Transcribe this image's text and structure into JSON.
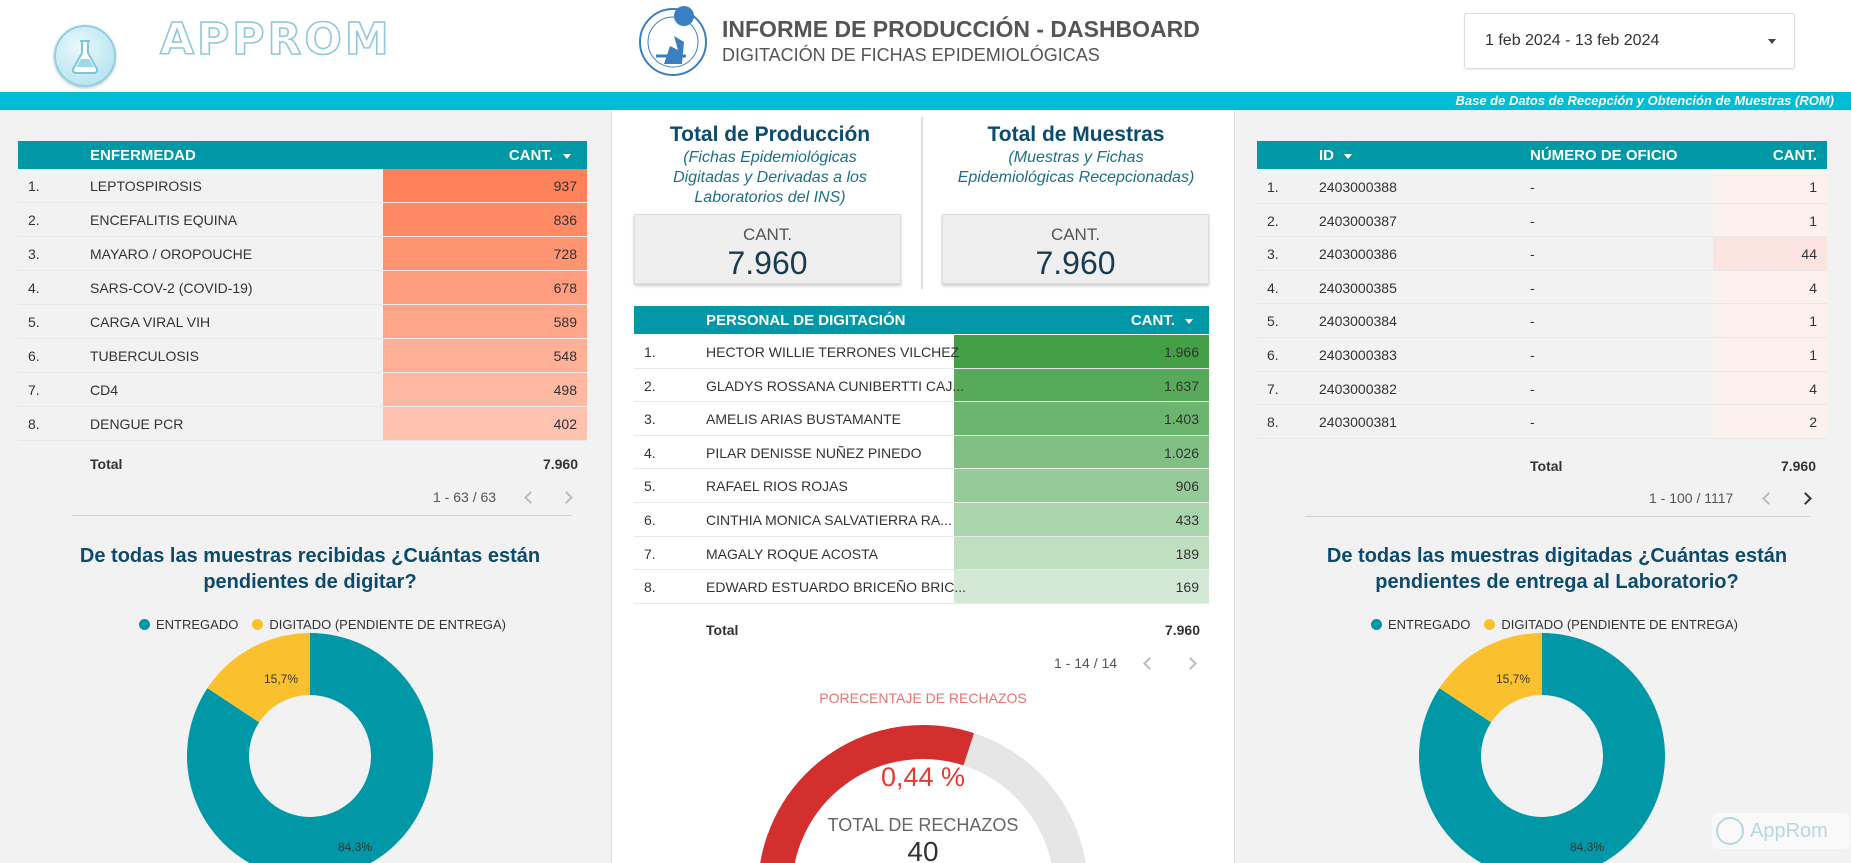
{
  "header": {
    "logo_text": "APPROM",
    "title": "INFORME DE PRODUCCIÓN - DASHBOARD",
    "subtitle": "DIGITACIÓN DE FICHAS EPIDEMIOLÓGICAS",
    "date_range": "1 feb 2024 - 13 feb 2024",
    "band_text": "Base de Datos de Recepción y Obtención de Muestras (ROM)"
  },
  "enfermedad_table": {
    "headers": [
      "ENFERMEDAD",
      "CANT."
    ],
    "rows": [
      {
        "n": "1.",
        "name": "LEPTOSPIROSIS",
        "val": "937",
        "v": 937
      },
      {
        "n": "2.",
        "name": "ENCEFALITIS EQUINA",
        "val": "836",
        "v": 836
      },
      {
        "n": "3.",
        "name": "MAYARO / OROPOUCHE",
        "val": "728",
        "v": 728
      },
      {
        "n": "4.",
        "name": "SARS-COV-2 (COVID-19)",
        "val": "678",
        "v": 678
      },
      {
        "n": "5.",
        "name": "CARGA VIRAL VIH",
        "val": "589",
        "v": 589
      },
      {
        "n": "6.",
        "name": "TUBERCULOSIS",
        "val": "548",
        "v": 548
      },
      {
        "n": "7.",
        "name": "CD4",
        "val": "498",
        "v": 498
      },
      {
        "n": "8.",
        "name": "DENGUE PCR",
        "val": "402",
        "v": 402
      }
    ],
    "total_label": "Total",
    "total_value": "7.960",
    "pagination": "1 - 63 / 63",
    "bar_color": "#ff7043"
  },
  "scorecards": {
    "produccion": {
      "title": "Total de Producción",
      "subtitle": "(Fichas Epidemiológicas Digitadas y Derivadas a los Laboratorios del INS)",
      "label": "CANT.",
      "value": "7.960"
    },
    "muestras": {
      "title": "Total de Muestras",
      "subtitle": "(Muestras y Fichas Epidemiológicas Recepcionadas)",
      "label": "CANT.",
      "value": "7.960"
    }
  },
  "personal_table": {
    "headers": [
      "PERSONAL DE DIGITACIÓN",
      "CANT."
    ],
    "rows": [
      {
        "n": "1.",
        "name": "HECTOR WILLIE TERRONES VILCHEZ",
        "val": "1.966",
        "v": 1966
      },
      {
        "n": "2.",
        "name": "GLADYS ROSSANA CUNIBERTTI CAJ...",
        "val": "1.637",
        "v": 1637
      },
      {
        "n": "3.",
        "name": "AMELIS ARIAS BUSTAMANTE",
        "val": "1.403",
        "v": 1403
      },
      {
        "n": "4.",
        "name": "PILAR DENISSE NUÑEZ PINEDO",
        "val": "1.026",
        "v": 1026
      },
      {
        "n": "5.",
        "name": "RAFAEL RIOS ROJAS",
        "val": "906",
        "v": 906
      },
      {
        "n": "6.",
        "name": "CINTHIA MONICA SALVATIERRA RA...",
        "val": "433",
        "v": 433
      },
      {
        "n": "7.",
        "name": "MAGALY ROQUE ACOSTA",
        "val": "189",
        "v": 189
      },
      {
        "n": "8.",
        "name": "EDWARD ESTUARDO BRICEÑO BRIC...",
        "val": "169",
        "v": 169
      }
    ],
    "total_label": "Total",
    "total_value": "7.960",
    "pagination": "1 - 14 / 14",
    "bar_color": "#43a047"
  },
  "gauge": {
    "title": "PORECENTAJE DE RECHAZOS",
    "percent_text": "0,44 %",
    "percent": 0.44,
    "label": "TOTAL DE RECHAZOS",
    "value": "40",
    "color": "#d32f2f"
  },
  "oficio_table": {
    "headers": [
      "ID",
      "NÚMERO DE OFICIO",
      "CANT."
    ],
    "rows": [
      {
        "n": "1.",
        "id": "2403000388",
        "oficio": "-",
        "val": "1",
        "v": 1
      },
      {
        "n": "2.",
        "id": "2403000387",
        "oficio": "-",
        "val": "1",
        "v": 1
      },
      {
        "n": "3.",
        "id": "2403000386",
        "oficio": "-",
        "val": "44",
        "v": 44
      },
      {
        "n": "4.",
        "id": "2403000385",
        "oficio": "-",
        "val": "4",
        "v": 4
      },
      {
        "n": "5.",
        "id": "2403000384",
        "oficio": "-",
        "val": "1",
        "v": 1
      },
      {
        "n": "6.",
        "id": "2403000383",
        "oficio": "-",
        "val": "1",
        "v": 1
      },
      {
        "n": "7.",
        "id": "2403000382",
        "oficio": "-",
        "val": "4",
        "v": 4
      },
      {
        "n": "8.",
        "id": "2403000381",
        "oficio": "-",
        "val": "2",
        "v": 2
      }
    ],
    "total_label": "Total",
    "total_value": "7.960",
    "pagination": "1 - 100 / 1117"
  },
  "donut_left": {
    "title": "De todas las muestras recibidas ¿Cuántas están pendientes de digitar?",
    "legend": [
      "ENTREGADO",
      "DIGITADO (PENDIENTE DE ENTREGA)"
    ],
    "colors": [
      "#0097a7",
      "#fbc02d"
    ],
    "label_entregado": "84,3%",
    "label_digitado": "15,7%"
  },
  "donut_right": {
    "title": "De todas las muestras digitadas ¿Cuántas están pendientes de entrega al Laboratorio?",
    "legend": [
      "ENTREGADO",
      "DIGITADO (PENDIENTE DE ENTREGA)"
    ],
    "colors": [
      "#0097a7",
      "#fbc02d"
    ],
    "label_entregado": "84,3%",
    "label_digitado": "15,7%"
  },
  "chart_data": [
    {
      "type": "pie",
      "title": "De todas las muestras recibidas ¿Cuántas están pendientes de digitar?",
      "categories": [
        "ENTREGADO",
        "DIGITADO (PENDIENTE DE ENTREGA)"
      ],
      "values": [
        84.3,
        15.7
      ]
    },
    {
      "type": "pie",
      "title": "De todas las muestras digitadas ¿Cuántas están pendientes de entrega al Laboratorio?",
      "categories": [
        "ENTREGADO",
        "DIGITADO (PENDIENTE DE ENTREGA)"
      ],
      "values": [
        84.3,
        15.7
      ]
    }
  ],
  "watermark": "AppRom"
}
